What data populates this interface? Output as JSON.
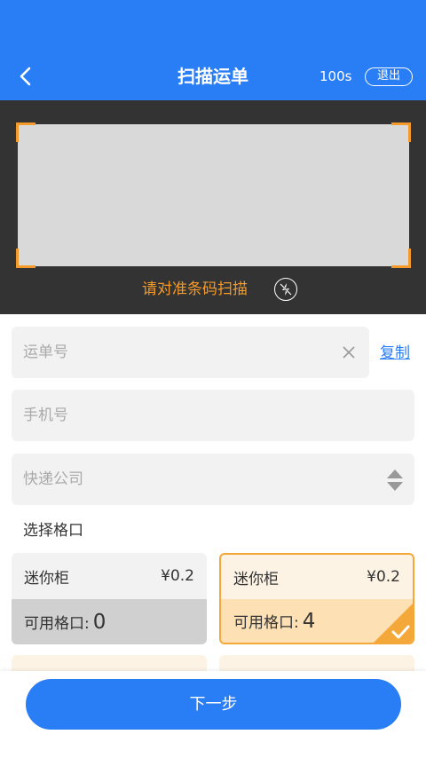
{
  "header": {
    "title": "扫描运单",
    "timer": "100s",
    "exit_label": "退出"
  },
  "scanner": {
    "hint": "请对准条码扫描",
    "flash_icon": "flash-off-icon"
  },
  "form": {
    "waybill_placeholder": "运单号",
    "copy_label": "复制",
    "phone_placeholder": "手机号",
    "company_placeholder": "快递公司"
  },
  "slots": {
    "section_label": "选择格口",
    "items": [
      {
        "name": "迷你柜",
        "price": "¥0.2",
        "available_label": "可用格口:",
        "count": "0",
        "state": "disabled"
      },
      {
        "name": "迷你柜",
        "price": "¥0.2",
        "available_label": "可用格口:",
        "count": "4",
        "state": "selected"
      }
    ]
  },
  "footer": {
    "next_label": "下一步"
  },
  "colors": {
    "primary": "#2a7ef5",
    "accent": "#f39a2a",
    "scan_bg": "#333333"
  }
}
